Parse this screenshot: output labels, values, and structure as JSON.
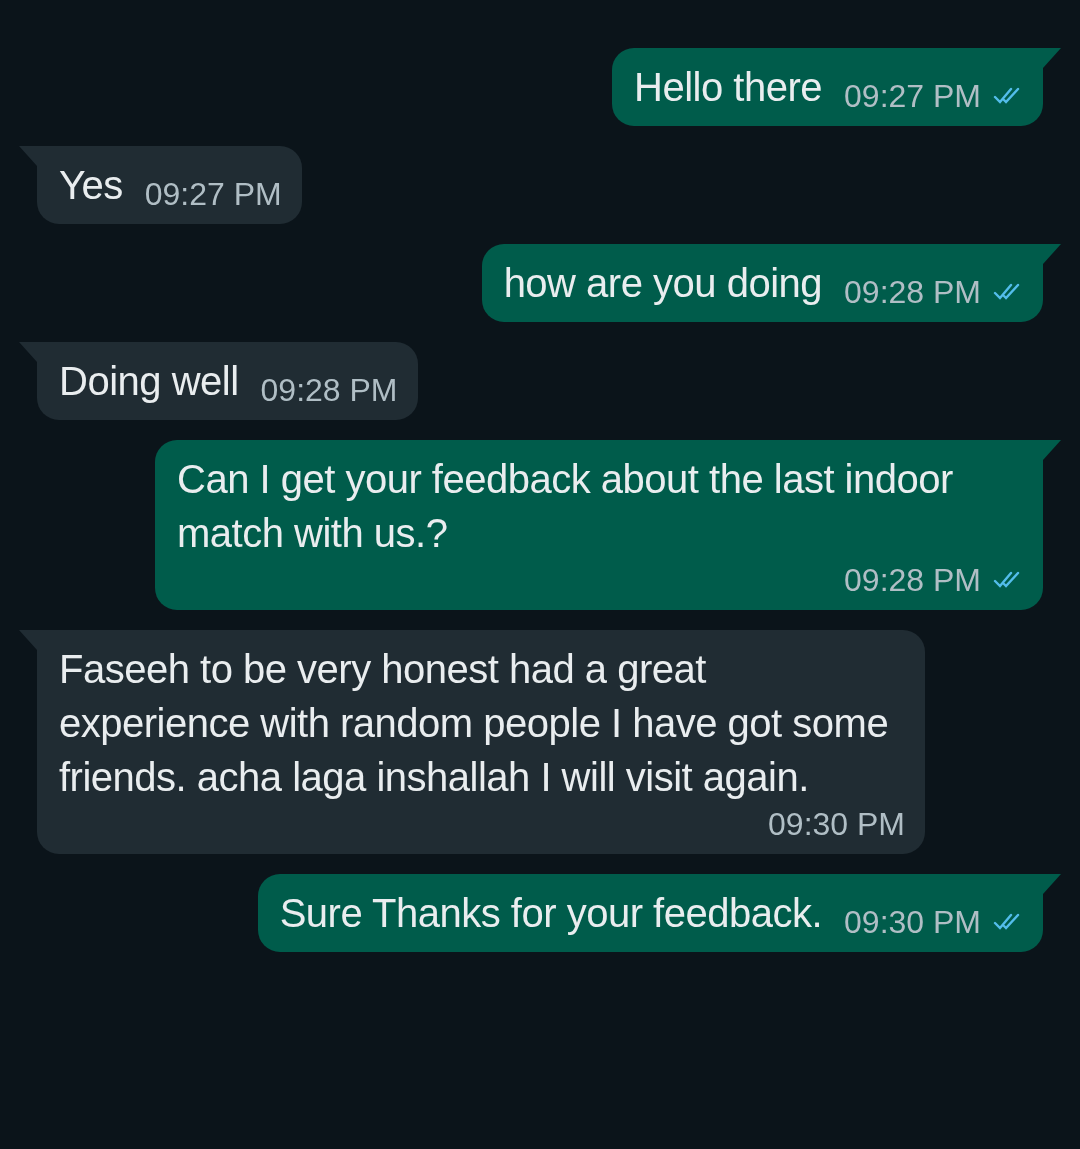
{
  "messages": [
    {
      "kind": "sent",
      "text": "Hello there",
      "time": "09:27 PM",
      "read": true
    },
    {
      "kind": "received",
      "text": "Yes",
      "time": "09:27 PM"
    },
    {
      "kind": "sent",
      "text": "how are you doing",
      "time": "09:28 PM",
      "read": true
    },
    {
      "kind": "received",
      "text": "Doing well",
      "time": "09:28 PM"
    },
    {
      "kind": "sent",
      "text": "Can I get your feedback about the last indoor match with us.?",
      "time": "09:28 PM",
      "read": true
    },
    {
      "kind": "received",
      "text": "Faseeh to be very honest had a great experience with random people I have got some friends. acha laga inshallah I will visit again.",
      "time": "09:30 PM"
    },
    {
      "kind": "sent",
      "text": "Sure Thanks for your feedback.",
      "time": "09:30 PM",
      "read": true
    }
  ]
}
